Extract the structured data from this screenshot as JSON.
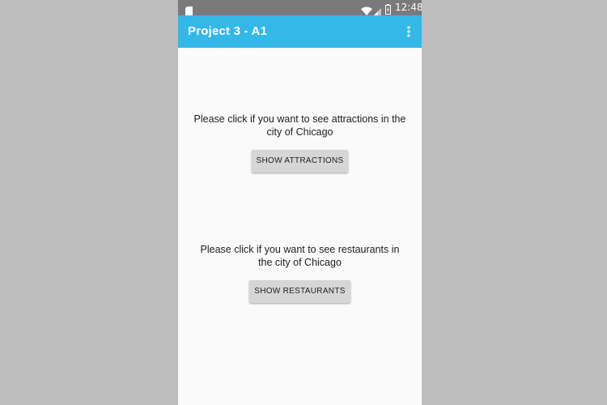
{
  "status_bar": {
    "time": "12:48",
    "icons": [
      "sd-card-icon",
      "wifi-icon",
      "signal-icon",
      "battery-icon"
    ]
  },
  "app_bar": {
    "title": "Project 3 - A1",
    "menu_icon": "overflow-menu-icon",
    "color": "#34b8e8"
  },
  "attractions": {
    "prompt": "Please click if you want to see attractions in the city of Chicago",
    "button_label": "SHOW ATTRACTIONS"
  },
  "restaurants": {
    "prompt": "Please click if you want to see restaurants in the city of Chicago",
    "button_label": "SHOW RESTAURANTS"
  }
}
